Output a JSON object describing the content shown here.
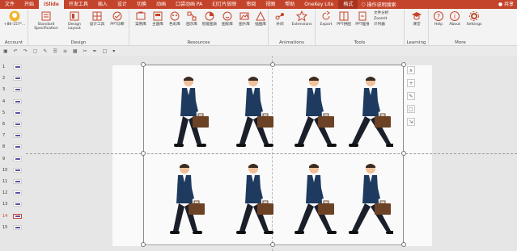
{
  "ribbon_tabs": [
    "文件",
    "开始",
    "iSlide",
    "开发工具",
    "插入",
    "设计",
    "切换",
    "动画",
    "口袋动画 PA",
    "幻灯片放映",
    "审阅",
    "视图",
    "帮助",
    "OneKey Lite",
    "格式"
  ],
  "active_tab": "iSlide",
  "format_tab": "格式",
  "search_hint": "操作说明搜索",
  "share_label": "共享",
  "groups": {
    "account": {
      "label": "Account",
      "user_text": "+86-157*..."
    },
    "design": {
      "label": "Design",
      "buttons": [
        "Standard Specification",
        "Design Layout",
        "设计工具",
        "PPT诊断"
      ]
    },
    "resources": {
      "label": "Resources",
      "buttons": [
        "案例库",
        "主题库",
        "色彩库",
        "图示库",
        "智能图表",
        "图标库",
        "图片库",
        "插图库"
      ]
    },
    "animations": {
      "label": "Animations",
      "buttons": [
        "补间",
        "Extensions"
      ]
    },
    "tools": {
      "label": "Tools",
      "buttons": [
        "Export",
        "PPT拼图",
        "PPT瘦身"
      ],
      "small": [
        "文件分析",
        "ZoomIt",
        "计时器"
      ]
    },
    "learning": {
      "label": "Learning",
      "buttons": [
        "课堂"
      ]
    },
    "more": {
      "label": "More",
      "buttons": [
        "Help",
        "About",
        "Settings"
      ]
    }
  },
  "slides": [
    {
      "num": "1"
    },
    {
      "num": "2"
    },
    {
      "num": "3"
    },
    {
      "num": "4"
    },
    {
      "num": "5"
    },
    {
      "num": "6"
    },
    {
      "num": "7"
    },
    {
      "num": "8"
    },
    {
      "num": "9"
    },
    {
      "num": "10"
    },
    {
      "num": "11"
    },
    {
      "num": "12"
    },
    {
      "num": "13"
    },
    {
      "num": "14",
      "active": true
    },
    {
      "num": "15"
    }
  ],
  "colors": {
    "tab_bar": "#c4442b",
    "suit": "#1e3a5f",
    "briefcase": "#6b4226",
    "skin": "#f0c09a",
    "hair": "#3b2a1f"
  },
  "figures": {
    "count": 8,
    "description_icon": "walking-businessman-with-briefcase"
  }
}
